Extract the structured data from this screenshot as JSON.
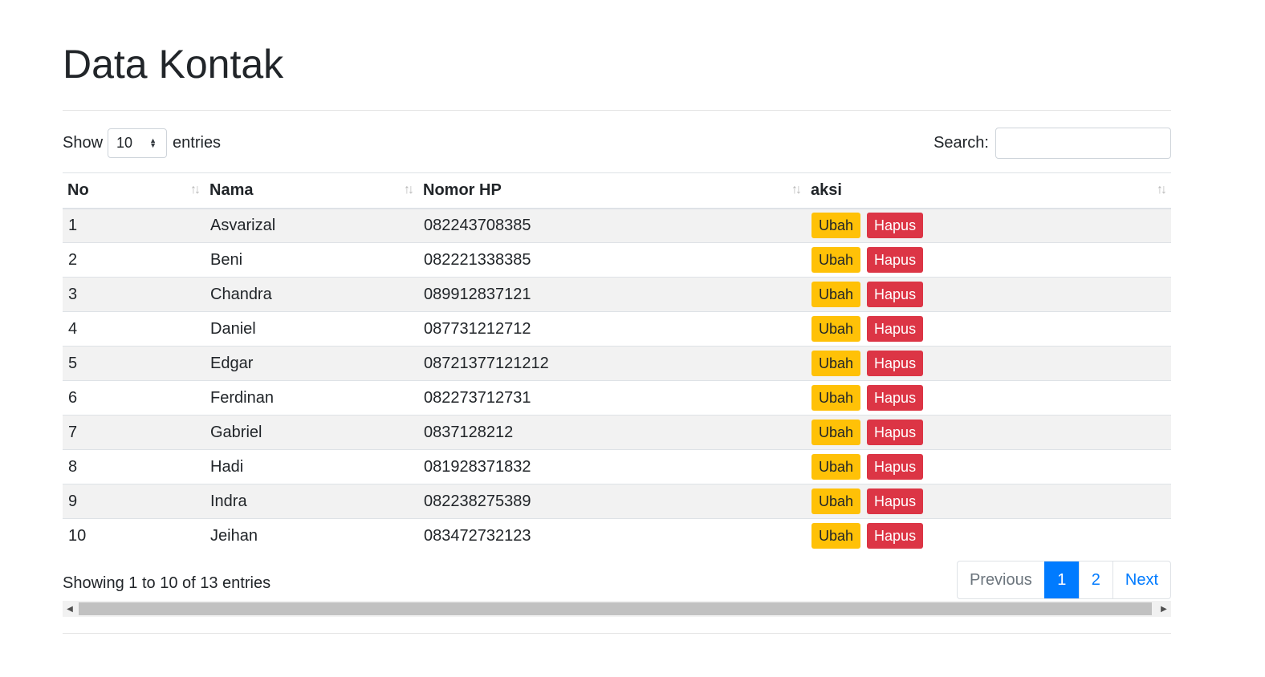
{
  "page": {
    "title": "Data Kontak"
  },
  "controls": {
    "show_label": "Show",
    "entries_label": "entries",
    "length_value": "10",
    "search_label": "Search:",
    "search_value": ""
  },
  "table": {
    "headers": [
      "No",
      "Nama",
      "Nomor HP",
      "aksi"
    ],
    "rows": [
      {
        "no": "1",
        "nama": "Asvarizal",
        "hp": "082243708385"
      },
      {
        "no": "2",
        "nama": "Beni",
        "hp": "082221338385"
      },
      {
        "no": "3",
        "nama": "Chandra",
        "hp": "089912837121"
      },
      {
        "no": "4",
        "nama": "Daniel",
        "hp": "087731212712"
      },
      {
        "no": "5",
        "nama": "Edgar",
        "hp": "08721377121212"
      },
      {
        "no": "6",
        "nama": "Ferdinan",
        "hp": "082273712731"
      },
      {
        "no": "7",
        "nama": "Gabriel",
        "hp": "0837128212"
      },
      {
        "no": "8",
        "nama": "Hadi",
        "hp": "081928371832"
      },
      {
        "no": "9",
        "nama": "Indra",
        "hp": "082238275389"
      },
      {
        "no": "10",
        "nama": "Jeihan",
        "hp": "083472732123"
      }
    ],
    "edit_label": "Ubah",
    "delete_label": "Hapus"
  },
  "footer": {
    "info": "Showing 1 to 10 of 13 entries",
    "previous": "Previous",
    "pages": [
      "1",
      "2"
    ],
    "next": "Next"
  },
  "colors": {
    "primary": "#007bff",
    "warning": "#ffc107",
    "danger": "#dc3545"
  }
}
